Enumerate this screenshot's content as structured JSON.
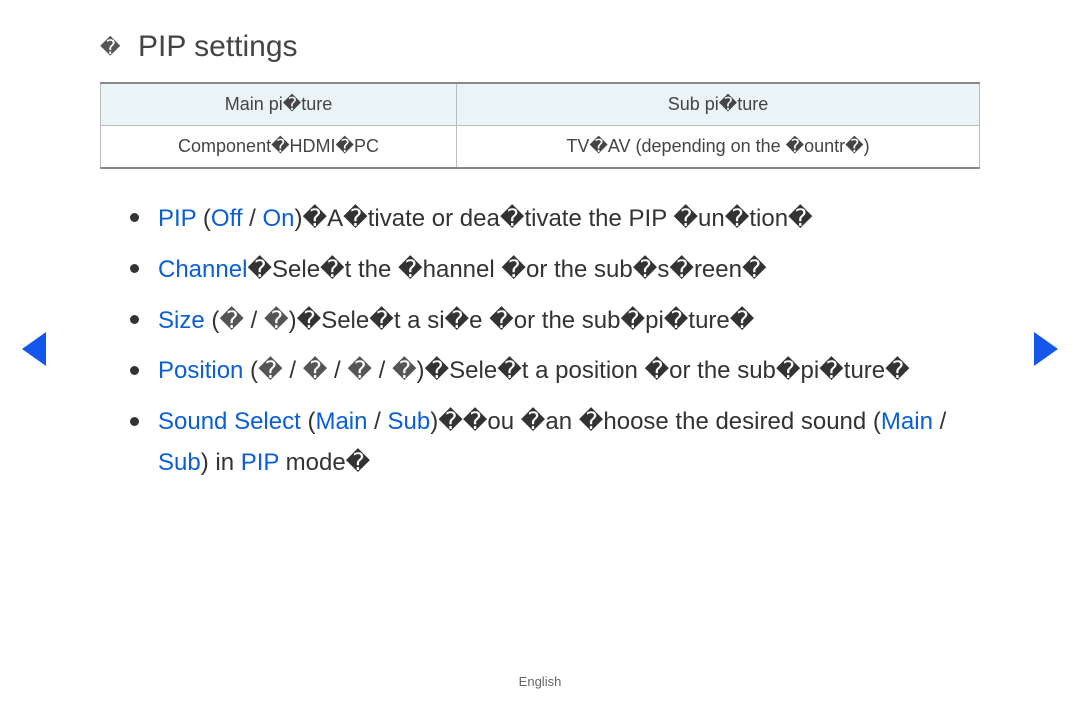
{
  "title": "PIP settings",
  "title_bullet": "�",
  "table": {
    "headers": [
      "Main pi�ture",
      "Sub pi�ture"
    ],
    "cells": [
      "Component�HDMI�PC",
      "TV�AV (depending on the �ountr�)"
    ]
  },
  "items": {
    "pip": {
      "key": "PIP",
      "off": "Off",
      "on": "On",
      "sep1": " (",
      "sep2": " / ",
      "sep3": ")�",
      "desc": "A�tivate or dea�tivate the PIP �un�tion�"
    },
    "channel": {
      "key": "Channel",
      "sep": "�",
      "desc": "Sele�t the �hannel �or the sub�s�reen�"
    },
    "size": {
      "key": "Size",
      "pre": " (",
      "g1": "�",
      "sep": " / ",
      "g2": "�",
      "post": ")�",
      "desc": "Sele�t a si�e �or the sub�pi�ture�"
    },
    "position": {
      "key": "Position",
      "pre": " (",
      "g1": "�",
      "sep1": " / ",
      "g2": "�",
      "sep2": " / ",
      "g3": "�",
      "sep3": " / ",
      "g4": "�",
      "post": ")�",
      "desc": "Sele�t a position �or the sub�pi�ture�"
    },
    "sound": {
      "key": "Sound Select",
      "pre": " (",
      "main": "Main",
      "sep": " / ",
      "sub": "Sub",
      "post": ")��",
      "mid1": "ou �an �hoose the desired sound (",
      "main2": "Main",
      "sep2": " / ",
      "sub2": "Sub",
      "mid2": ") in ",
      "pipkey": "PIP",
      "tail": " mode�"
    }
  },
  "footer": "English"
}
